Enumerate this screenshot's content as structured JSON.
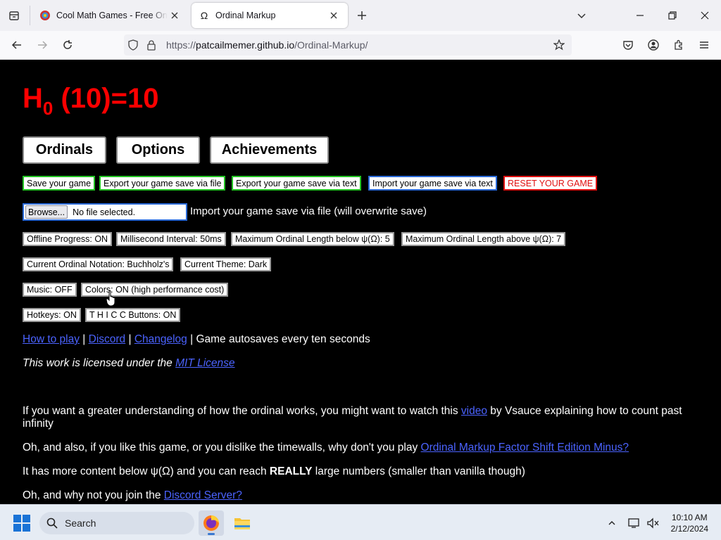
{
  "browser": {
    "tabs": [
      {
        "title": "Cool Math Games - Free Online Games",
        "active": false,
        "favicon": "coolmath-icon"
      },
      {
        "title": "Ordinal Markup",
        "active": true,
        "favicon": "omega-icon"
      }
    ],
    "url_prefix": "https://",
    "url_host": "patcailmemer.github.io",
    "url_path": "/Ordinal-Markup/"
  },
  "page": {
    "heading": {
      "prefix": "H",
      "subscript": "0",
      "suffix": " (10)=10",
      "color": "#ff0000"
    },
    "main_tabs": [
      {
        "label": "Ordinals"
      },
      {
        "label": "Options"
      },
      {
        "label": "Achievements"
      }
    ],
    "save_buttons": [
      {
        "label": "Save your game",
        "color": "green"
      },
      {
        "label": "Export your game save via file",
        "color": "green"
      },
      {
        "label": "Export your game save via text",
        "color": "green"
      },
      {
        "label": "Import your game save via text",
        "color": "blue"
      },
      {
        "label": "RESET YOUR GAME",
        "color": "red"
      }
    ],
    "file_import": {
      "browse_label": "Browse...",
      "status": "No file selected.",
      "label": "Import your game save via file (will overwrite save)"
    },
    "options_row1": [
      {
        "label": "Offline Progress: ON"
      },
      {
        "label": "Millisecond Interval: 50ms"
      },
      {
        "label": "Maximum Ordinal Length below ψ(Ω): 5"
      },
      {
        "label": "Maximum Ordinal Length above ψ(Ω): 7"
      }
    ],
    "options_row2": [
      {
        "label": "Current Ordinal Notation: Buchholz's"
      },
      {
        "label": "Current Theme: Dark"
      }
    ],
    "options_row3": [
      {
        "label": "Music: OFF"
      },
      {
        "label": "Colors: ON (high performance cost)"
      }
    ],
    "options_row4": [
      {
        "label": "Hotkeys: ON"
      },
      {
        "label": "T H I C C Buttons: ON"
      }
    ],
    "links": {
      "how_to_play": "How to play",
      "discord": "Discord",
      "changelog": "Changelog",
      "sep": " | ",
      "autosave": "Game autosaves every ten seconds"
    },
    "license": {
      "prefix": "This work is licensed under the ",
      "link": "MIT License"
    },
    "para1": {
      "before": "If you want a greater understanding of how the ordinal works, you might want to watch this ",
      "link": "video",
      "after": " by Vsauce explaining how to count past infinity"
    },
    "para2": {
      "before": "Oh, and also, if you like this game, or you dislike the timewalls, why don't you play ",
      "link": "Ordinal Markup Factor Shift Edition Minus?"
    },
    "para3": {
      "before": "It has more content below ψ(Ω) and you can reach ",
      "bold": "REALLY",
      "after": " large numbers (smaller than vanilla though)"
    },
    "para4": {
      "before": "Oh, and why not you join the ",
      "link": "Discord Server?"
    }
  },
  "taskbar": {
    "search_label": "Search",
    "time": "10:10 AM",
    "date": "2/12/2024"
  }
}
